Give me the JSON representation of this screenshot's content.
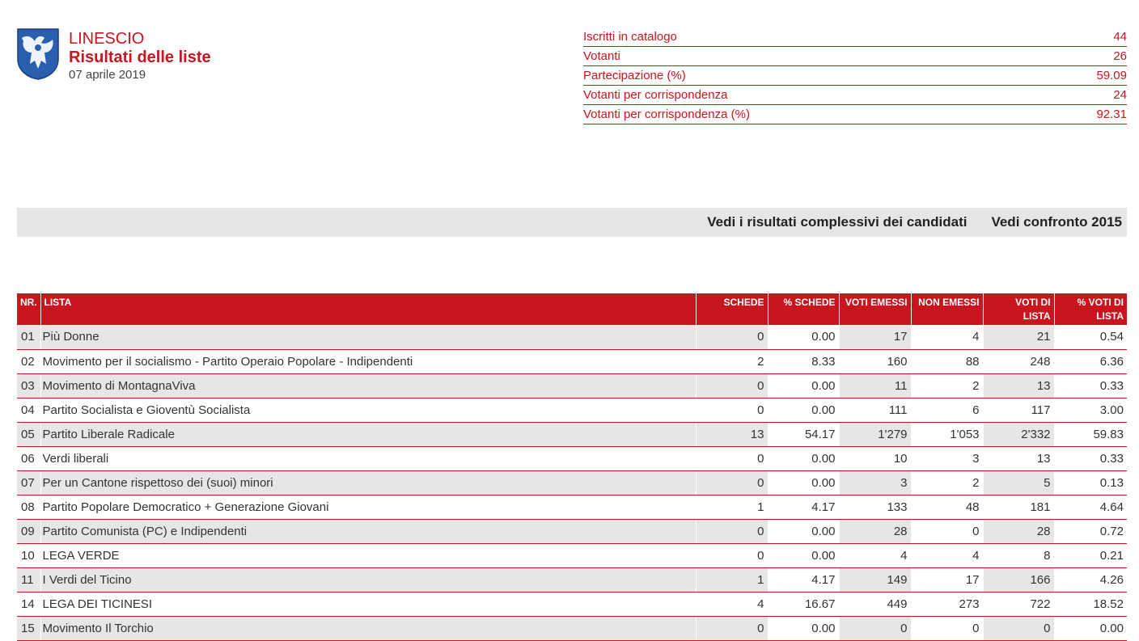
{
  "header": {
    "municipality": "LINESCIO",
    "page_title": "Risultati delle liste",
    "date": "07 aprile 2019"
  },
  "stats": [
    {
      "label": "Iscritti in catalogo",
      "value": "44"
    },
    {
      "label": "Votanti",
      "value": "26"
    },
    {
      "label": "Partecipazione (%)",
      "value": "59.09"
    },
    {
      "label": "Votanti per corrispondenza",
      "value": "24"
    },
    {
      "label": "Votanti per corrispondenza (%)",
      "value": "92.31"
    }
  ],
  "links": {
    "candidates": "Vedi i risultati complessivi dei candidati",
    "comparison": "Vedi confronto 2015"
  },
  "table": {
    "headers": {
      "nr": "Nr.",
      "lista": "LISTA",
      "schede": "SCHEDE",
      "pct_schede": "% SCHEDE",
      "voti_emessi": "VOTI EMESSI",
      "non_emessi": "NON EMESSI",
      "voti_lista": "VOTI DI LISTA",
      "pct_voti_lista": "% VOTI DI LISTA"
    },
    "rows": [
      {
        "nr": "01",
        "name": "Più Donne",
        "schede": "0",
        "pct_schede": "0.00",
        "voti_emessi": "17",
        "non_emessi": "4",
        "voti_lista": "21",
        "pct_voti_lista": "0.54"
      },
      {
        "nr": "02",
        "name": "Movimento per il socialismo - Partito Operaio Popolare - Indipendenti",
        "schede": "2",
        "pct_schede": "8.33",
        "voti_emessi": "160",
        "non_emessi": "88",
        "voti_lista": "248",
        "pct_voti_lista": "6.36"
      },
      {
        "nr": "03",
        "name": "Movimento di MontagnaViva",
        "schede": "0",
        "pct_schede": "0.00",
        "voti_emessi": "11",
        "non_emessi": "2",
        "voti_lista": "13",
        "pct_voti_lista": "0.33"
      },
      {
        "nr": "04",
        "name": "Partito Socialista e Gioventù Socialista",
        "schede": "0",
        "pct_schede": "0.00",
        "voti_emessi": "111",
        "non_emessi": "6",
        "voti_lista": "117",
        "pct_voti_lista": "3.00"
      },
      {
        "nr": "05",
        "name": "Partito Liberale Radicale",
        "schede": "13",
        "pct_schede": "54.17",
        "voti_emessi": "1'279",
        "non_emessi": "1'053",
        "voti_lista": "2'332",
        "pct_voti_lista": "59.83"
      },
      {
        "nr": "06",
        "name": "Verdi liberali",
        "schede": "0",
        "pct_schede": "0.00",
        "voti_emessi": "10",
        "non_emessi": "3",
        "voti_lista": "13",
        "pct_voti_lista": "0.33"
      },
      {
        "nr": "07",
        "name": "Per un Cantone rispettoso dei (suoi) minori",
        "schede": "0",
        "pct_schede": "0.00",
        "voti_emessi": "3",
        "non_emessi": "2",
        "voti_lista": "5",
        "pct_voti_lista": "0.13"
      },
      {
        "nr": "08",
        "name": "Partito Popolare Democratico + Generazione Giovani",
        "schede": "1",
        "pct_schede": "4.17",
        "voti_emessi": "133",
        "non_emessi": "48",
        "voti_lista": "181",
        "pct_voti_lista": "4.64"
      },
      {
        "nr": "09",
        "name": "Partito Comunista (PC) e Indipendenti",
        "schede": "0",
        "pct_schede": "0.00",
        "voti_emessi": "28",
        "non_emessi": "0",
        "voti_lista": "28",
        "pct_voti_lista": "0.72"
      },
      {
        "nr": "10",
        "name": "LEGA VERDE",
        "schede": "0",
        "pct_schede": "0.00",
        "voti_emessi": "4",
        "non_emessi": "4",
        "voti_lista": "8",
        "pct_voti_lista": "0.21"
      },
      {
        "nr": "11",
        "name": "I Verdi del Ticino",
        "schede": "1",
        "pct_schede": "4.17",
        "voti_emessi": "149",
        "non_emessi": "17",
        "voti_lista": "166",
        "pct_voti_lista": "4.26"
      },
      {
        "nr": "14",
        "name": "LEGA DEI TICINESI",
        "schede": "4",
        "pct_schede": "16.67",
        "voti_emessi": "449",
        "non_emessi": "273",
        "voti_lista": "722",
        "pct_voti_lista": "18.52"
      },
      {
        "nr": "15",
        "name": "Movimento Il Torchio",
        "schede": "0",
        "pct_schede": "0.00",
        "voti_emessi": "0",
        "non_emessi": "0",
        "voti_lista": "0",
        "pct_voti_lista": "0.00"
      }
    ]
  },
  "colors": {
    "accent": "#c8151e",
    "row_alt": "#e6e6e6",
    "logo_blue": "#2a5fb0"
  },
  "icons": {
    "logo": "municipal-coat-of-arms-icon"
  }
}
